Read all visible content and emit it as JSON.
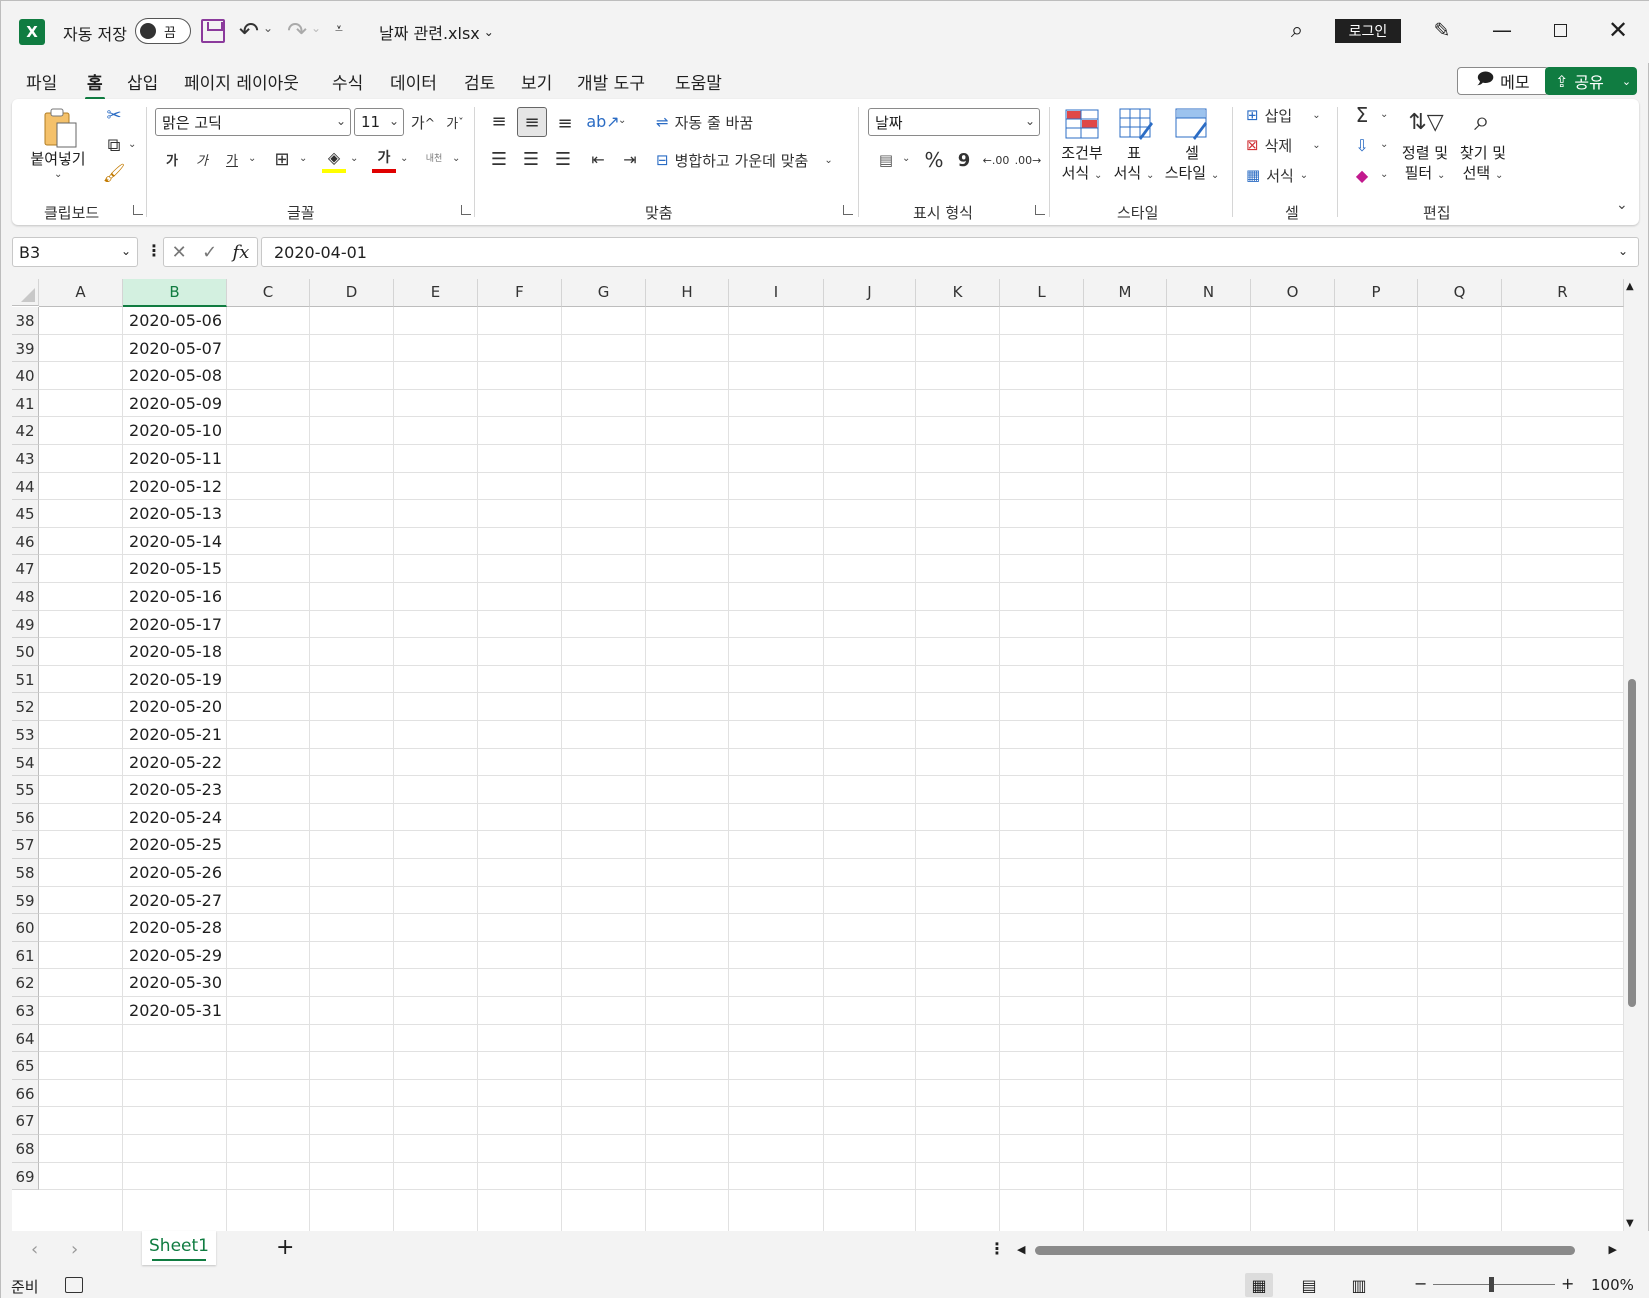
{
  "titlebar": {
    "autosave_label": "자동 저장",
    "autosave_state": "끔",
    "doc_title": "날짜 관련.xlsx",
    "signin_label": "로그인"
  },
  "tabs": [
    "파일",
    "홈",
    "삽입",
    "페이지 레이아웃",
    "수식",
    "데이터",
    "검토",
    "보기",
    "개발 도구",
    "도움말"
  ],
  "active_tab": "홈",
  "memo_label": "메모",
  "share_label": "공유",
  "ribbon": {
    "clipboard": {
      "paste_label": "붙여넣기",
      "group": "클립보드"
    },
    "font": {
      "font_name": "맑은 고딕",
      "font_size": "11",
      "bold": "가",
      "italic": "가",
      "underline": "가",
      "font_color_glyph": "가",
      "grow": "가",
      "shrink": "가",
      "phonetic": "내천",
      "group": "글꼴"
    },
    "alignment": {
      "wrap_text": "자동 줄 바꿈",
      "merge_center": "병합하고 가운데 맞춤",
      "group": "맞춤"
    },
    "number": {
      "format": "날짜",
      "percent": "%",
      "comma": "9",
      "group": "표시 형식"
    },
    "styles": {
      "conditional_line1": "조건부",
      "conditional_line2": "서식",
      "table_line1": "표",
      "table_line2": "서식",
      "cell_line1": "셀",
      "cell_line2": "스타일",
      "group": "스타일"
    },
    "cells": {
      "insert": "삽입",
      "delete": "삭제",
      "format": "서식",
      "group": "셀"
    },
    "editing": {
      "sort_line1": "정렬 및",
      "sort_line2": "필터",
      "find_line1": "찾기 및",
      "find_line2": "선택",
      "group": "편집"
    }
  },
  "formula_bar": {
    "name_box": "B3",
    "fx": "fx",
    "value": "2020-04-01"
  },
  "columns": [
    "A",
    "B",
    "C",
    "D",
    "E",
    "F",
    "G",
    "H",
    "I",
    "J",
    "K",
    "L",
    "M",
    "N",
    "O",
    "P",
    "Q",
    "R"
  ],
  "selected_column": "B",
  "rows": [
    {
      "num": "38",
      "b": "2020-05-06"
    },
    {
      "num": "39",
      "b": "2020-05-07"
    },
    {
      "num": "40",
      "b": "2020-05-08"
    },
    {
      "num": "41",
      "b": "2020-05-09"
    },
    {
      "num": "42",
      "b": "2020-05-10"
    },
    {
      "num": "43",
      "b": "2020-05-11"
    },
    {
      "num": "44",
      "b": "2020-05-12"
    },
    {
      "num": "45",
      "b": "2020-05-13"
    },
    {
      "num": "46",
      "b": "2020-05-14"
    },
    {
      "num": "47",
      "b": "2020-05-15"
    },
    {
      "num": "48",
      "b": "2020-05-16"
    },
    {
      "num": "49",
      "b": "2020-05-17"
    },
    {
      "num": "50",
      "b": "2020-05-18"
    },
    {
      "num": "51",
      "b": "2020-05-19"
    },
    {
      "num": "52",
      "b": "2020-05-20"
    },
    {
      "num": "53",
      "b": "2020-05-21"
    },
    {
      "num": "54",
      "b": "2020-05-22"
    },
    {
      "num": "55",
      "b": "2020-05-23"
    },
    {
      "num": "56",
      "b": "2020-05-24"
    },
    {
      "num": "57",
      "b": "2020-05-25"
    },
    {
      "num": "58",
      "b": "2020-05-26"
    },
    {
      "num": "59",
      "b": "2020-05-27"
    },
    {
      "num": "60",
      "b": "2020-05-28"
    },
    {
      "num": "61",
      "b": "2020-05-29"
    },
    {
      "num": "62",
      "b": "2020-05-30"
    },
    {
      "num": "63",
      "b": "2020-05-31"
    },
    {
      "num": "64",
      "b": ""
    },
    {
      "num": "65",
      "b": ""
    },
    {
      "num": "66",
      "b": ""
    },
    {
      "num": "67",
      "b": ""
    },
    {
      "num": "68",
      "b": ""
    },
    {
      "num": "69",
      "b": ""
    }
  ],
  "sheet_tab": "Sheet1",
  "status": {
    "ready": "준비",
    "zoom": "100%"
  },
  "colors": {
    "accent": "#107c41",
    "excel_green": "#107c41"
  }
}
